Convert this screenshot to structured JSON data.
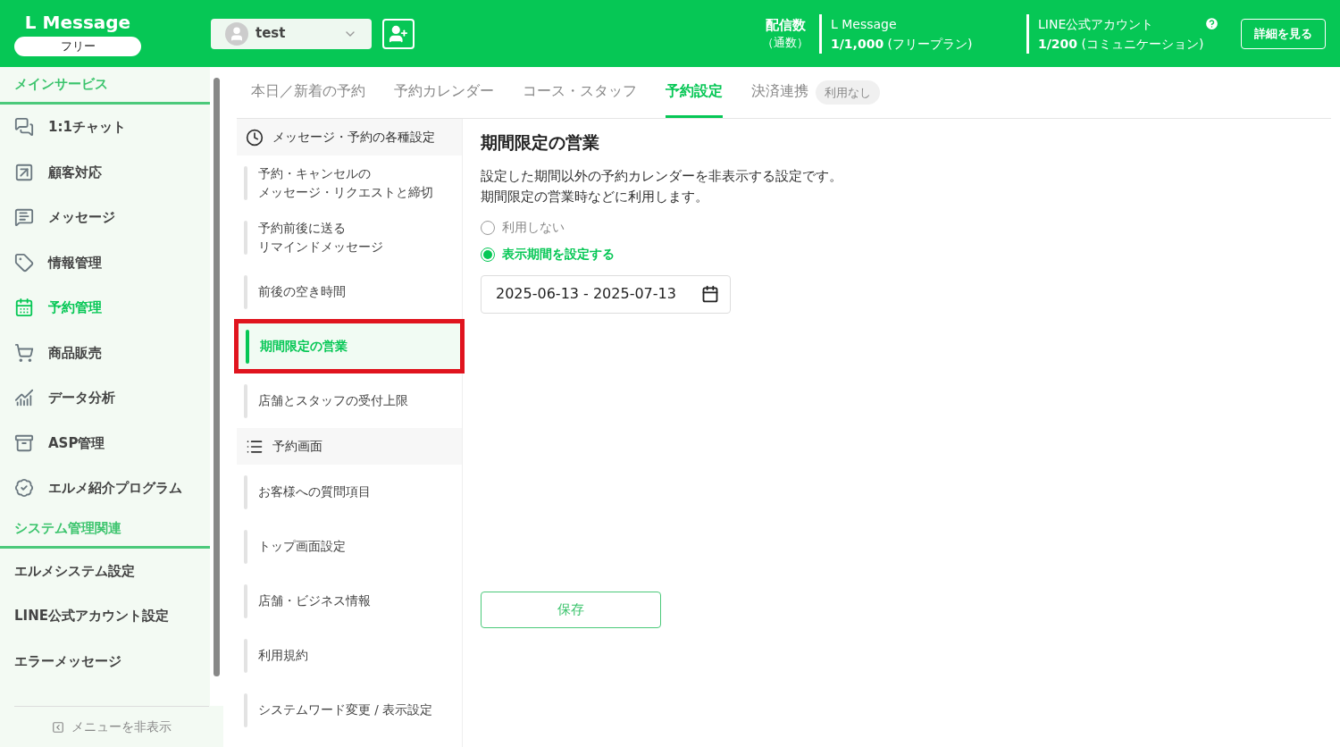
{
  "header": {
    "logo": "L Message",
    "plan_badge": "フリー",
    "account": {
      "name": "test"
    },
    "stats_label": "配信数",
    "stats_sublabel": "（通数）",
    "stats": [
      {
        "title": "L Message",
        "count": "1/1,000",
        "note": "(フリープラン)"
      },
      {
        "title": "LINE公式アカウント",
        "count": "1/200",
        "note": "(コミュニケーション)"
      }
    ],
    "details_button": "詳細を見る"
  },
  "sidebar": {
    "sections": [
      {
        "title": "メインサービス",
        "items": [
          {
            "label": "1:1チャット",
            "selected": false
          },
          {
            "label": "顧客対応",
            "selected": false
          },
          {
            "label": "メッセージ",
            "selected": false
          },
          {
            "label": "情報管理",
            "selected": false
          },
          {
            "label": "予約管理",
            "selected": true
          },
          {
            "label": "商品販売",
            "selected": false
          },
          {
            "label": "データ分析",
            "selected": false
          },
          {
            "label": "ASP管理",
            "selected": false
          },
          {
            "label": "エルメ紹介プログラム",
            "selected": false
          }
        ]
      },
      {
        "title": "システム管理関連",
        "items": [
          {
            "label": "エルメシステム設定",
            "selected": false
          },
          {
            "label": "LINE公式アカウント設定",
            "selected": false
          },
          {
            "label": "エラーメッセージ",
            "selected": false
          }
        ]
      }
    ],
    "hide_menu": "メニューを非表示"
  },
  "tabs": [
    {
      "label": "本日／新着の予約",
      "selected": false
    },
    {
      "label": "予約カレンダー",
      "selected": false
    },
    {
      "label": "コース・スタッフ",
      "selected": false
    },
    {
      "label": "予約設定",
      "selected": true
    },
    {
      "label": "決済連携",
      "selected": false,
      "badge": "利用なし"
    }
  ],
  "subnav": [
    {
      "title": "メッセージ・予約の各種設定",
      "items": [
        {
          "lines": [
            "予約・キャンセルの",
            "メッセージ・リクエストと締切"
          ],
          "selected": false,
          "highlighted": false
        },
        {
          "lines": [
            "予約前後に送る",
            "リマインドメッセージ"
          ],
          "selected": false,
          "highlighted": false
        },
        {
          "lines": [
            "前後の空き時間"
          ],
          "selected": false,
          "highlighted": false
        },
        {
          "lines": [
            "期間限定の営業"
          ],
          "selected": true,
          "highlighted": true
        },
        {
          "lines": [
            "店舗とスタッフの受付上限"
          ],
          "selected": false,
          "highlighted": false
        }
      ]
    },
    {
      "title": "予約画面",
      "items": [
        {
          "lines": [
            "お客様への質問項目"
          ],
          "selected": false,
          "highlighted": false
        },
        {
          "lines": [
            "トップ画面設定"
          ],
          "selected": false,
          "highlighted": false
        },
        {
          "lines": [
            "店舗・ビジネス情報"
          ],
          "selected": false,
          "highlighted": false
        },
        {
          "lines": [
            "利用規約"
          ],
          "selected": false,
          "highlighted": false
        },
        {
          "lines": [
            "システムワード変更 / 表示設定"
          ],
          "selected": false,
          "highlighted": false
        }
      ]
    }
  ],
  "content": {
    "title": "期間限定の営業",
    "description": [
      "設定した期間以外の予約カレンダーを非表示する設定です。",
      "期間限定の営業時などに利用します。"
    ],
    "options": [
      {
        "label": "利用しない",
        "selected": false
      },
      {
        "label": "表示期間を設定する",
        "selected": true
      }
    ],
    "date_range": "2025-06-13 - 2025-07-13",
    "save_button": "保存"
  }
}
